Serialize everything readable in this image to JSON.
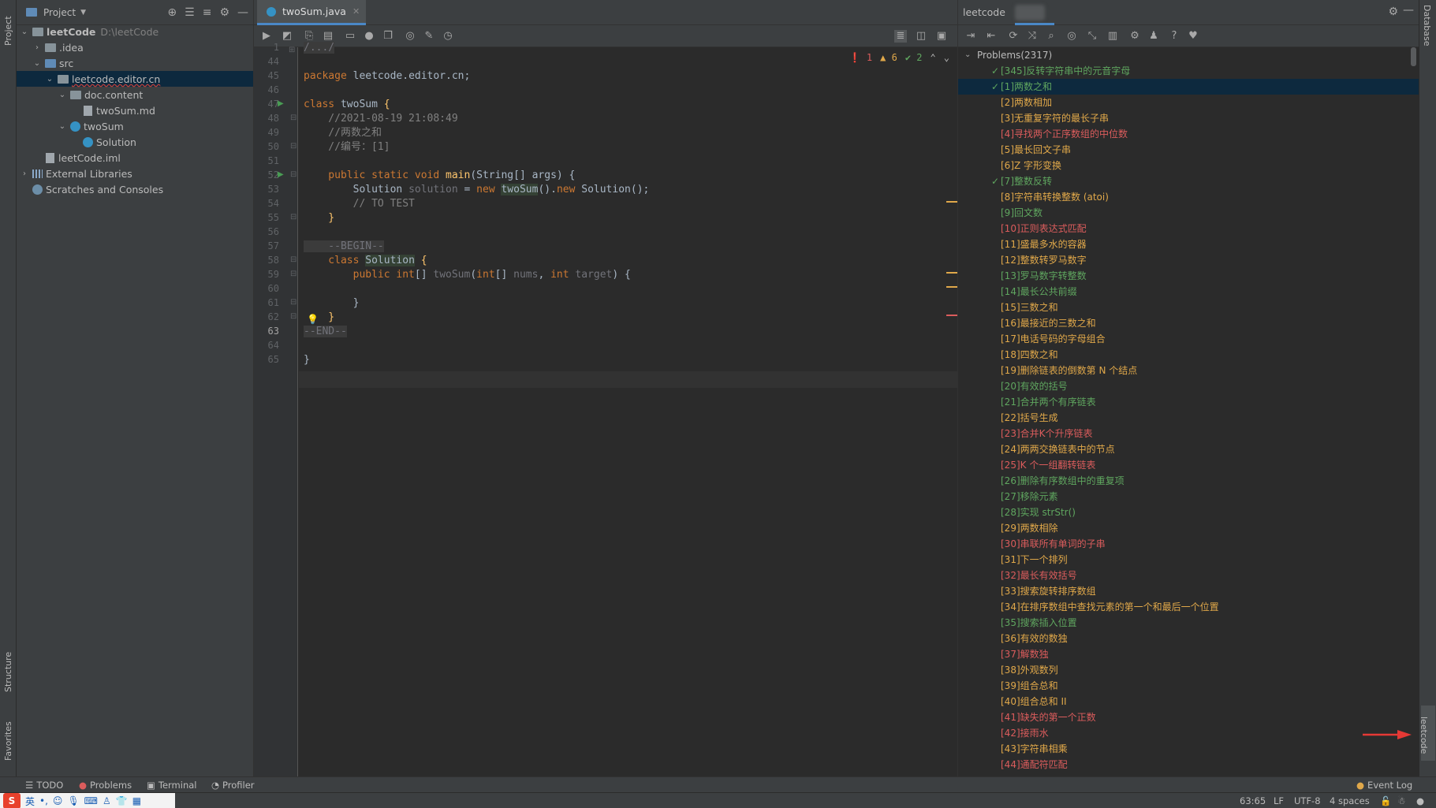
{
  "left_stripe": {
    "project_tab": "Project",
    "structure_tab": "Structure",
    "favorites_tab": "Favorites"
  },
  "project": {
    "title": "Project",
    "tree": [
      {
        "label": "leetCode",
        "path": "D:\\leetCode",
        "depth": 0,
        "type": "folder",
        "expanded": true,
        "bold": true
      },
      {
        "label": ".idea",
        "depth": 1,
        "type": "folder",
        "expanded": false
      },
      {
        "label": "src",
        "depth": 1,
        "type": "folder-blue",
        "expanded": true
      },
      {
        "label": "leetcode.editor.cn",
        "depth": 2,
        "type": "package",
        "expanded": true,
        "selected": true
      },
      {
        "label": "doc.content",
        "depth": 3,
        "type": "package",
        "expanded": true
      },
      {
        "label": "twoSum.md",
        "depth": 4,
        "type": "file"
      },
      {
        "label": "twoSum",
        "depth": 3,
        "type": "class",
        "expanded": true
      },
      {
        "label": "Solution",
        "depth": 4,
        "type": "class"
      },
      {
        "label": "leetCode.iml",
        "depth": 1,
        "type": "file"
      },
      {
        "label": "External Libraries",
        "depth": 0,
        "type": "lib",
        "expanded": false
      },
      {
        "label": "Scratches and Consoles",
        "depth": 0,
        "type": "scratch"
      }
    ]
  },
  "editor": {
    "tab_label": "twoSum.java",
    "inspection": {
      "errors": "1",
      "warnings": "6",
      "ok": "2"
    },
    "line_numbers": [
      "1",
      "44",
      "45",
      "46",
      "47",
      "48",
      "49",
      "50",
      "51",
      "52",
      "53",
      "54",
      "55",
      "56",
      "57",
      "58",
      "59",
      "60",
      "61",
      "62",
      "63",
      "64",
      "65"
    ],
    "current_line": "63"
  },
  "code": {
    "l1": "/.../",
    "l45_kw": "package ",
    "l45_rest": "leetcode.editor.cn;",
    "l47_kw": "class ",
    "l47_name": "twoSum ",
    "l47_brace": "{",
    "l48": "    //2021-08-19 21:08:49",
    "l49": "    //两数之和",
    "l50": "    //编号：[1]",
    "l52_kw": "    public static void ",
    "l52_fn": "main",
    "l52_rest": "(String[] args) {",
    "l53_a": "        Solution ",
    "l53_var": "solution",
    "l53_b": " = ",
    "l53_new": "new ",
    "l53_cls": "twoSum",
    "l53_c": "().",
    "l53_new2": "new ",
    "l53_d": "Solution();",
    "l54": "        // TO TEST",
    "l55": "    }",
    "l57": "    --BEGIN--",
    "l58_kw": "    class ",
    "l58_name": "Solution",
    "l58_rest": " {",
    "l59_kw": "        public int",
    "l59_a": "[] ",
    "l59_fn": "twoSum",
    "l59_b": "(",
    "l59_kw2": "int",
    "l59_c": "[] ",
    "l59_p1": "nums",
    "l59_d": ", ",
    "l59_kw3": "int ",
    "l59_p2": "target",
    "l59_e": ") {",
    "l61": "        }",
    "l62": "    }",
    "l63": "--END--",
    "l65": "}"
  },
  "leetcode": {
    "title": "leetcode",
    "root": "Problems(2317)",
    "problems": [
      {
        "label": "[345]反转字符串中的元音字母",
        "diff": "easy",
        "solved": true
      },
      {
        "label": "[1]两数之和",
        "diff": "easy",
        "solved": true,
        "selected": true
      },
      {
        "label": "[2]两数相加",
        "diff": "medium",
        "solved": false
      },
      {
        "label": "[3]无重复字符的最长子串",
        "diff": "medium",
        "solved": false
      },
      {
        "label": "[4]寻找两个正序数组的中位数",
        "diff": "hard",
        "solved": false
      },
      {
        "label": "[5]最长回文子串",
        "diff": "medium",
        "solved": false
      },
      {
        "label": "[6]Z 字形变换",
        "diff": "medium",
        "solved": false
      },
      {
        "label": "[7]整数反转",
        "diff": "easy",
        "solved": true
      },
      {
        "label": "[8]字符串转换整数 (atoi)",
        "diff": "medium",
        "solved": false
      },
      {
        "label": "[9]回文数",
        "diff": "easy",
        "solved": false
      },
      {
        "label": "[10]正则表达式匹配",
        "diff": "hard",
        "solved": false
      },
      {
        "label": "[11]盛最多水的容器",
        "diff": "medium",
        "solved": false
      },
      {
        "label": "[12]整数转罗马数字",
        "diff": "medium",
        "solved": false
      },
      {
        "label": "[13]罗马数字转整数",
        "diff": "easy",
        "solved": false
      },
      {
        "label": "[14]最长公共前缀",
        "diff": "easy",
        "solved": false
      },
      {
        "label": "[15]三数之和",
        "diff": "medium",
        "solved": false
      },
      {
        "label": "[16]最接近的三数之和",
        "diff": "medium",
        "solved": false
      },
      {
        "label": "[17]电话号码的字母组合",
        "diff": "medium",
        "solved": false
      },
      {
        "label": "[18]四数之和",
        "diff": "medium",
        "solved": false
      },
      {
        "label": "[19]删除链表的倒数第 N 个结点",
        "diff": "medium",
        "solved": false
      },
      {
        "label": "[20]有效的括号",
        "diff": "easy",
        "solved": false
      },
      {
        "label": "[21]合并两个有序链表",
        "diff": "easy",
        "solved": false
      },
      {
        "label": "[22]括号生成",
        "diff": "medium",
        "solved": false
      },
      {
        "label": "[23]合并K个升序链表",
        "diff": "hard",
        "solved": false
      },
      {
        "label": "[24]两两交换链表中的节点",
        "diff": "medium",
        "solved": false
      },
      {
        "label": "[25]K 个一组翻转链表",
        "diff": "hard",
        "solved": false
      },
      {
        "label": "[26]删除有序数组中的重复项",
        "diff": "easy",
        "solved": false
      },
      {
        "label": "[27]移除元素",
        "diff": "easy",
        "solved": false
      },
      {
        "label": "[28]实现 strStr()",
        "diff": "easy",
        "solved": false
      },
      {
        "label": "[29]两数相除",
        "diff": "medium",
        "solved": false
      },
      {
        "label": "[30]串联所有单词的子串",
        "diff": "hard",
        "solved": false
      },
      {
        "label": "[31]下一个排列",
        "diff": "medium",
        "solved": false
      },
      {
        "label": "[32]最长有效括号",
        "diff": "hard",
        "solved": false
      },
      {
        "label": "[33]搜索旋转排序数组",
        "diff": "medium",
        "solved": false
      },
      {
        "label": "[34]在排序数组中查找元素的第一个和最后一个位置",
        "diff": "medium",
        "solved": false
      },
      {
        "label": "[35]搜索插入位置",
        "diff": "easy",
        "solved": false
      },
      {
        "label": "[36]有效的数独",
        "diff": "medium",
        "solved": false
      },
      {
        "label": "[37]解数独",
        "diff": "hard",
        "solved": false
      },
      {
        "label": "[38]外观数列",
        "diff": "medium",
        "solved": false
      },
      {
        "label": "[39]组合总和",
        "diff": "medium",
        "solved": false
      },
      {
        "label": "[40]组合总和 II",
        "diff": "medium",
        "solved": false
      },
      {
        "label": "[41]缺失的第一个正数",
        "diff": "hard",
        "solved": false
      },
      {
        "label": "[42]接雨水",
        "diff": "hard",
        "solved": false
      },
      {
        "label": "[43]字符串相乘",
        "diff": "medium",
        "solved": false
      },
      {
        "label": "[44]通配符匹配",
        "diff": "hard",
        "solved": false
      }
    ]
  },
  "right_stripe": {
    "database_tab": "Database",
    "leetcode_tab": "leetcode"
  },
  "bottom_tools": {
    "todo": "TODO",
    "problems": "Problems",
    "terminal": "Terminal",
    "profiler": "Profiler",
    "event_log": "Event Log"
  },
  "status": {
    "position": "63:65",
    "line_sep": "LF",
    "encoding": "UTF-8",
    "indent": "4 spaces"
  },
  "ime": {
    "lang": "英"
  },
  "colors": {
    "easy": "#5fa65f",
    "medium": "#e0a84a",
    "hard": "#db5c5c",
    "selection": "#0d293e",
    "accent": "#4a88c7"
  }
}
